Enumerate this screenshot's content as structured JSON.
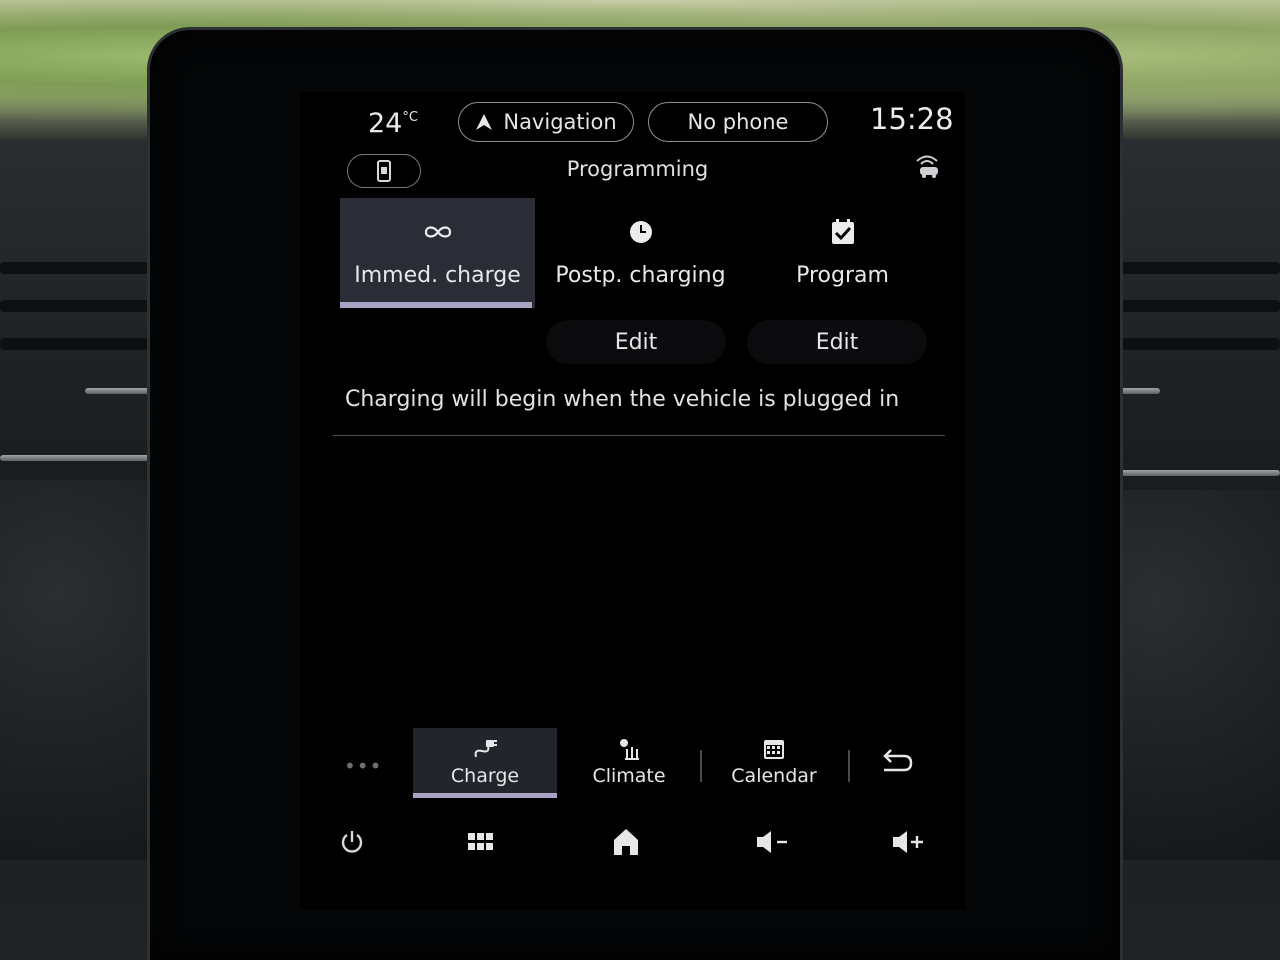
{
  "status_bar": {
    "temperature": "24",
    "temperature_unit": "°C",
    "navigation_label": "Navigation",
    "phone_label": "No phone",
    "time": "15:28"
  },
  "header": {
    "title": "Programming"
  },
  "charge_modes": [
    {
      "label": "Immed. charge",
      "icon": "infinity-icon",
      "active": true
    },
    {
      "label": "Postp. charging",
      "icon": "clock-icon",
      "active": false
    },
    {
      "label": "Program",
      "icon": "calendar-check-icon",
      "active": false
    }
  ],
  "edit_buttons": [
    "Edit",
    "Edit"
  ],
  "message": "Charging will begin when the vehicle is plugged in",
  "shortcuts": [
    {
      "label": "Charge",
      "icon": "plug-icon",
      "active": true
    },
    {
      "label": "Climate",
      "icon": "climate-icon",
      "active": false
    },
    {
      "label": "Calendar",
      "icon": "calendar-icon",
      "active": false
    }
  ],
  "more_label": "•••",
  "system_buttons": [
    "power-icon",
    "apps-grid-icon",
    "home-icon",
    "volume-down-icon",
    "volume-up-icon"
  ],
  "colors": {
    "screen_bg": "#000000",
    "active_tab_bg": "#2a2c36",
    "active_indicator": "#a7a3c4",
    "text": "#e6e6e8"
  }
}
